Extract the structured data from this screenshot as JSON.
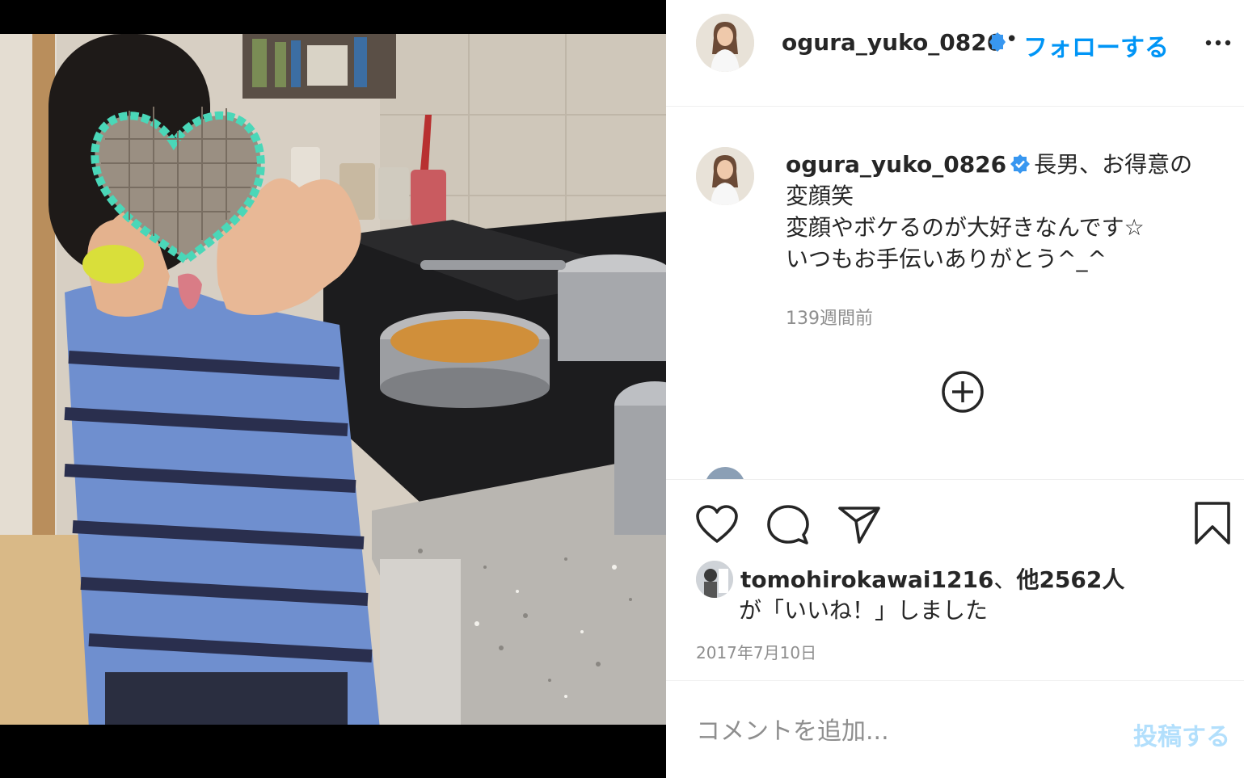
{
  "post": {
    "author": {
      "username": "ogura_yuko_0826",
      "verified": true,
      "verified_color": "#3897f0"
    },
    "header": {
      "separator": "•",
      "follow_label": "フォローする",
      "more_icon": "more-dots-icon"
    },
    "caption": {
      "username": "ogura_yuko_0826",
      "lines": [
        "長男、お得意の",
        "変顔笑",
        "変顔やボケるのが大好きなんです☆",
        "いつもお手伝いありがとう^_^"
      ],
      "time_ago": "139週間前",
      "load_more_icon": "plus-circle-icon"
    },
    "actions": {
      "like_icon": "heart-icon",
      "comment_icon": "comment-icon",
      "share_icon": "paper-plane-icon",
      "save_icon": "bookmark-icon"
    },
    "likes": {
      "liker": "tomohirokawai1216",
      "joiner": "、",
      "others": "他2562人",
      "suffix": "が「いいね！」しました"
    },
    "date": "2017年7月10日",
    "comment_box": {
      "placeholder": "コメントを追加...",
      "post_label": "投稿する",
      "post_color": "#b2dffc"
    },
    "colors": {
      "accent": "#0095f6",
      "text": "#262626",
      "muted": "#8e8e8e"
    }
  }
}
